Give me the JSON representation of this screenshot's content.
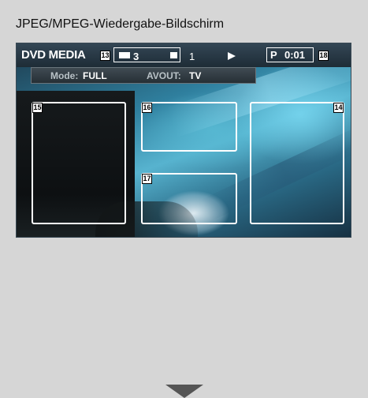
{
  "heading": "JPEG/MPEG-Wiedergabe-Bildschirm",
  "screen": {
    "title": "DVD MEDIA",
    "folder_number": "3",
    "file_number": "1",
    "play_state_icon": "play-icon",
    "p_label": "P",
    "time": "0:01",
    "mode_label": "Mode:",
    "mode_value": "FULL",
    "avout_label": "AVOUT:",
    "avout_value": "TV"
  },
  "callouts": {
    "folder": "13",
    "time": "18",
    "zone_left": "15",
    "zone_top_center": "16",
    "zone_bottom_center": "17",
    "zone_right": "14"
  },
  "colors": {
    "page_background": "#d6d6d6",
    "topbar": "#1e2c36",
    "arrow": "#555555"
  }
}
